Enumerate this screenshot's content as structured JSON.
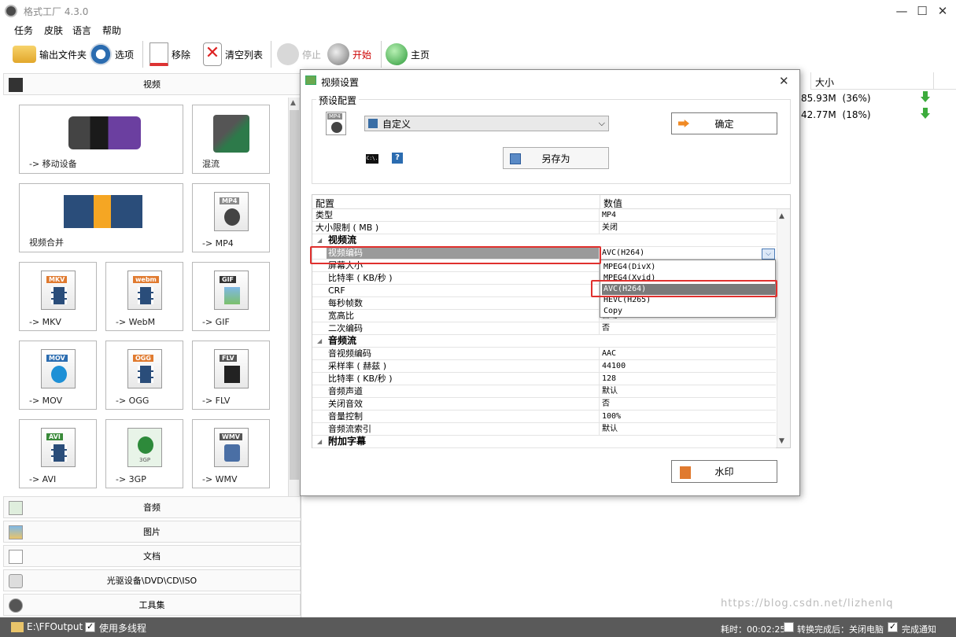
{
  "app": {
    "title": "格式工厂 4.3.0",
    "minimize_icon": "minimize-icon",
    "maximize_icon": "maximize-icon",
    "close_icon": "close-icon"
  },
  "menu": [
    "任务",
    "皮肤",
    "语言",
    "帮助"
  ],
  "toolbar": {
    "output_folder": "输出文件夹",
    "options": "选项",
    "remove": "移除",
    "clear_list": "清空列表",
    "stop": "停止",
    "start": "开始",
    "home": "主页"
  },
  "sidebar": {
    "video_header": "视频",
    "tiles": [
      {
        "label": "-> 移动设备"
      },
      {
        "label": "混流"
      },
      {
        "label": "视频合并"
      },
      {
        "label": "-> MP4",
        "badge": "MP4"
      },
      {
        "label": "-> MKV",
        "badge": "MKV"
      },
      {
        "label": "-> WebM",
        "badge": "webm"
      },
      {
        "label": "-> GIF",
        "badge": "GIF"
      },
      {
        "label": "-> MOV",
        "badge": "MOV"
      },
      {
        "label": "-> OGG",
        "badge": "OGG"
      },
      {
        "label": "-> FLV",
        "badge": "FLV"
      },
      {
        "label": "-> AVI",
        "badge": "AVI"
      },
      {
        "label": "-> 3GP",
        "badge": "3GP"
      },
      {
        "label": "-> WMV",
        "badge": "WMV"
      }
    ],
    "categories": [
      "音频",
      "图片",
      "文档",
      "光驱设备\\DVD\\CD\\ISO",
      "工具集"
    ]
  },
  "right_pane": {
    "col_size": "大小",
    "rows": [
      {
        "size": "85.93M",
        "pct": "(36%)"
      },
      {
        "size": "42.77M",
        "pct": "(18%)"
      }
    ]
  },
  "dialog": {
    "title": "视频设置",
    "preset_group": "预设配置",
    "preset_value": "自定义",
    "ok": "确定",
    "save_as": "另存为",
    "watermark": "水印",
    "mp4_badge": "MP4",
    "cmd_label": "C:\\.",
    "help_label": "?",
    "grid_headers": {
      "key": "配置",
      "value": "数值"
    },
    "rows": [
      {
        "k": "类型",
        "v": "MP4"
      },
      {
        "k": "大小限制 ( MB )",
        "v": "关闭"
      },
      {
        "k": "视频流",
        "v": "",
        "section": true
      },
      {
        "k": "视频编码",
        "v": "AVC(H264)",
        "indent": true,
        "selected": true
      },
      {
        "k": "屏幕大小",
        "v": "",
        "indent": true
      },
      {
        "k": "比特率 ( KB/秒 )",
        "v": "",
        "indent": true
      },
      {
        "k": "CRF",
        "v": "",
        "indent": true
      },
      {
        "k": "每秒帧数",
        "v": "",
        "indent": true
      },
      {
        "k": "宽高比",
        "v": "自动",
        "indent": true
      },
      {
        "k": "二次编码",
        "v": "否",
        "indent": true
      },
      {
        "k": "音频流",
        "v": "",
        "section": true
      },
      {
        "k": "音视频编码",
        "v": "AAC",
        "indent": true
      },
      {
        "k": "采样率 ( 赫兹 )",
        "v": "44100",
        "indent": true
      },
      {
        "k": "比特率 ( KB/秒 )",
        "v": "128",
        "indent": true
      },
      {
        "k": "音频声道",
        "v": "默认",
        "indent": true
      },
      {
        "k": "关闭音效",
        "v": "否",
        "indent": true
      },
      {
        "k": "音量控制",
        "v": "100%",
        "indent": true
      },
      {
        "k": "音频流索引",
        "v": "默认",
        "indent": true
      },
      {
        "k": "附加字幕",
        "v": "",
        "section": true
      }
    ],
    "codec_options": [
      "MPEG4(DivX)",
      "MPEG4(Xvid)",
      "AVC(H264)",
      "HEVC(H265)",
      "Copy"
    ],
    "codec_selected": "AVC(H264)"
  },
  "statusbar": {
    "output_path": "E:\\FFOutput",
    "multithread": "使用多线程",
    "elapsed": "耗时：00:02:25",
    "shutdown": "转换完成后：关闭电脑",
    "notify": "完成通知"
  },
  "watermark_text": "https://blog.csdn.net/lizhenlq"
}
